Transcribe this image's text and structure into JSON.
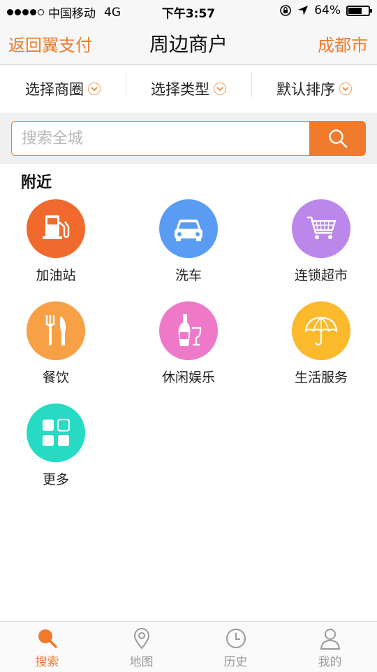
{
  "status_bar": {
    "carrier": "中国移动",
    "network": "4G",
    "time": "下午3:57",
    "battery_percent": "64%",
    "battery_level": 0.64
  },
  "nav": {
    "back_label": "返回翼支付",
    "title": "周边商户",
    "city_label": "成都市"
  },
  "filters": [
    {
      "label": "选择商圈",
      "icon": "chevron-down-icon"
    },
    {
      "label": "选择类型",
      "icon": "chevron-down-icon"
    },
    {
      "label": "默认排序",
      "icon": "chevron-down-icon"
    }
  ],
  "search": {
    "placeholder": "搜索全城",
    "value": "",
    "button_icon": "search-icon"
  },
  "section": {
    "title": "附近"
  },
  "categories": [
    {
      "label": "加油站",
      "icon": "gas-station-icon",
      "color": "#f06a2e"
    },
    {
      "label": "洗车",
      "icon": "car-icon",
      "color": "#5a9cf3"
    },
    {
      "label": "连锁超市",
      "icon": "shopping-cart-icon",
      "color": "#bb87eb"
    },
    {
      "label": "餐饮",
      "icon": "fork-knife-icon",
      "color": "#f7a046"
    },
    {
      "label": "休闲娱乐",
      "icon": "wine-icon",
      "color": "#ee79c9"
    },
    {
      "label": "生活服务",
      "icon": "umbrella-icon",
      "color": "#fbb92c"
    },
    {
      "label": "更多",
      "icon": "grid-icon",
      "color": "#27dac3"
    }
  ],
  "tabs": [
    {
      "label": "搜索",
      "icon": "search-icon",
      "active": true
    },
    {
      "label": "地图",
      "icon": "map-pin-icon",
      "active": false
    },
    {
      "label": "历史",
      "icon": "clock-icon",
      "active": false
    },
    {
      "label": "我的",
      "icon": "person-icon",
      "active": false
    }
  ],
  "colors": {
    "accent": "#f07b2c",
    "tab_inactive": "#9a9a9a"
  }
}
